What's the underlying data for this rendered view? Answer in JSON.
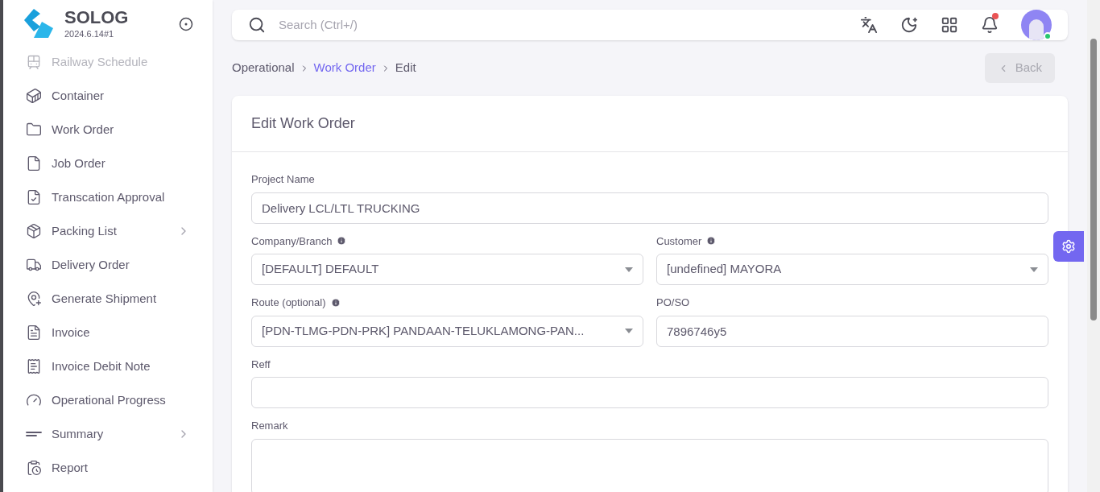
{
  "brand": {
    "name": "SOLOG",
    "version": "2024.6.14#1"
  },
  "sidebar": {
    "items": [
      {
        "label": "Railway Schedule",
        "disabled": true,
        "expandable": false
      },
      {
        "label": "Container",
        "disabled": false,
        "expandable": false
      },
      {
        "label": "Work Order",
        "disabled": false,
        "expandable": false
      },
      {
        "label": "Job Order",
        "disabled": false,
        "expandable": false
      },
      {
        "label": "Transcation Approval",
        "disabled": false,
        "expandable": false
      },
      {
        "label": "Packing List",
        "disabled": false,
        "expandable": true
      },
      {
        "label": "Delivery Order",
        "disabled": false,
        "expandable": false
      },
      {
        "label": "Generate Shipment",
        "disabled": false,
        "expandable": false
      },
      {
        "label": "Invoice",
        "disabled": false,
        "expandable": false
      },
      {
        "label": "Invoice Debit Note",
        "disabled": false,
        "expandable": false
      },
      {
        "label": "Operational Progress",
        "disabled": false,
        "expandable": false
      },
      {
        "label": "Summary",
        "disabled": false,
        "expandable": true
      },
      {
        "label": "Report",
        "disabled": false,
        "expandable": false
      }
    ]
  },
  "search": {
    "placeholder": "Search (Ctrl+/)"
  },
  "notifications": {
    "unread": true
  },
  "user": {
    "online": true
  },
  "breadcrumb": [
    {
      "label": "Operational",
      "link": false
    },
    {
      "label": "Work Order",
      "link": true
    },
    {
      "label": "Edit",
      "link": false
    }
  ],
  "back_button": {
    "label": "Back",
    "disabled": true
  },
  "card": {
    "title": "Edit Work Order",
    "rows": [
      [
        {
          "label": "Project Name",
          "kind": "text",
          "info": false,
          "value": "Delivery LCL/LTL TRUCKING"
        }
      ],
      [
        {
          "label": "Company/Branch",
          "kind": "select",
          "info": true,
          "value": "[DEFAULT] DEFAULT"
        },
        {
          "label": "Customer",
          "kind": "select",
          "info": true,
          "value": "[undefined] MAYORA"
        }
      ],
      [
        {
          "label": "Route (optional)",
          "kind": "select",
          "info": true,
          "value": "[PDN-TLMG-PDN-PRK] PANDAAN-TELUKLAMONG-PAN..."
        },
        {
          "label": "PO/SO",
          "kind": "text",
          "info": false,
          "value": "7896746y5"
        }
      ],
      [
        {
          "label": "Reff",
          "kind": "text",
          "info": false
        }
      ],
      [
        {
          "label": "Remark",
          "kind": "textarea",
          "info": false
        }
      ]
    ]
  }
}
